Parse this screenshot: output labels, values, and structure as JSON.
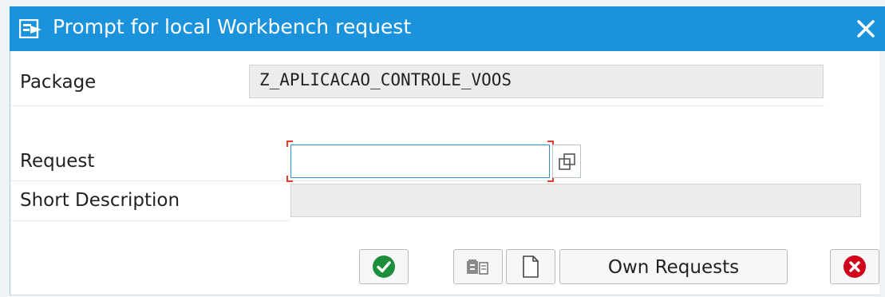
{
  "dialog": {
    "title": "Prompt for local Workbench request",
    "title_icon": "transport-request-icon",
    "close_icon": "close-icon"
  },
  "fields": {
    "package": {
      "label": "Package",
      "value": "Z_APLICACAO_CONTROLE_VOOS"
    },
    "request": {
      "label": "Request",
      "value": ""
    },
    "short_description": {
      "label": "Short Description",
      "value": ""
    }
  },
  "buttons": {
    "continue_icon": "checkmark-icon",
    "create_icon": "create-request-icon",
    "new_icon": "blank-document-icon",
    "own_requests_label": "Own Requests",
    "cancel_icon": "cancel-icon"
  },
  "colors": {
    "titlebar": "#1b93dc",
    "continue": "#1d8f3c",
    "cancel": "#d0021b",
    "required_marker": "#e63a2e"
  }
}
